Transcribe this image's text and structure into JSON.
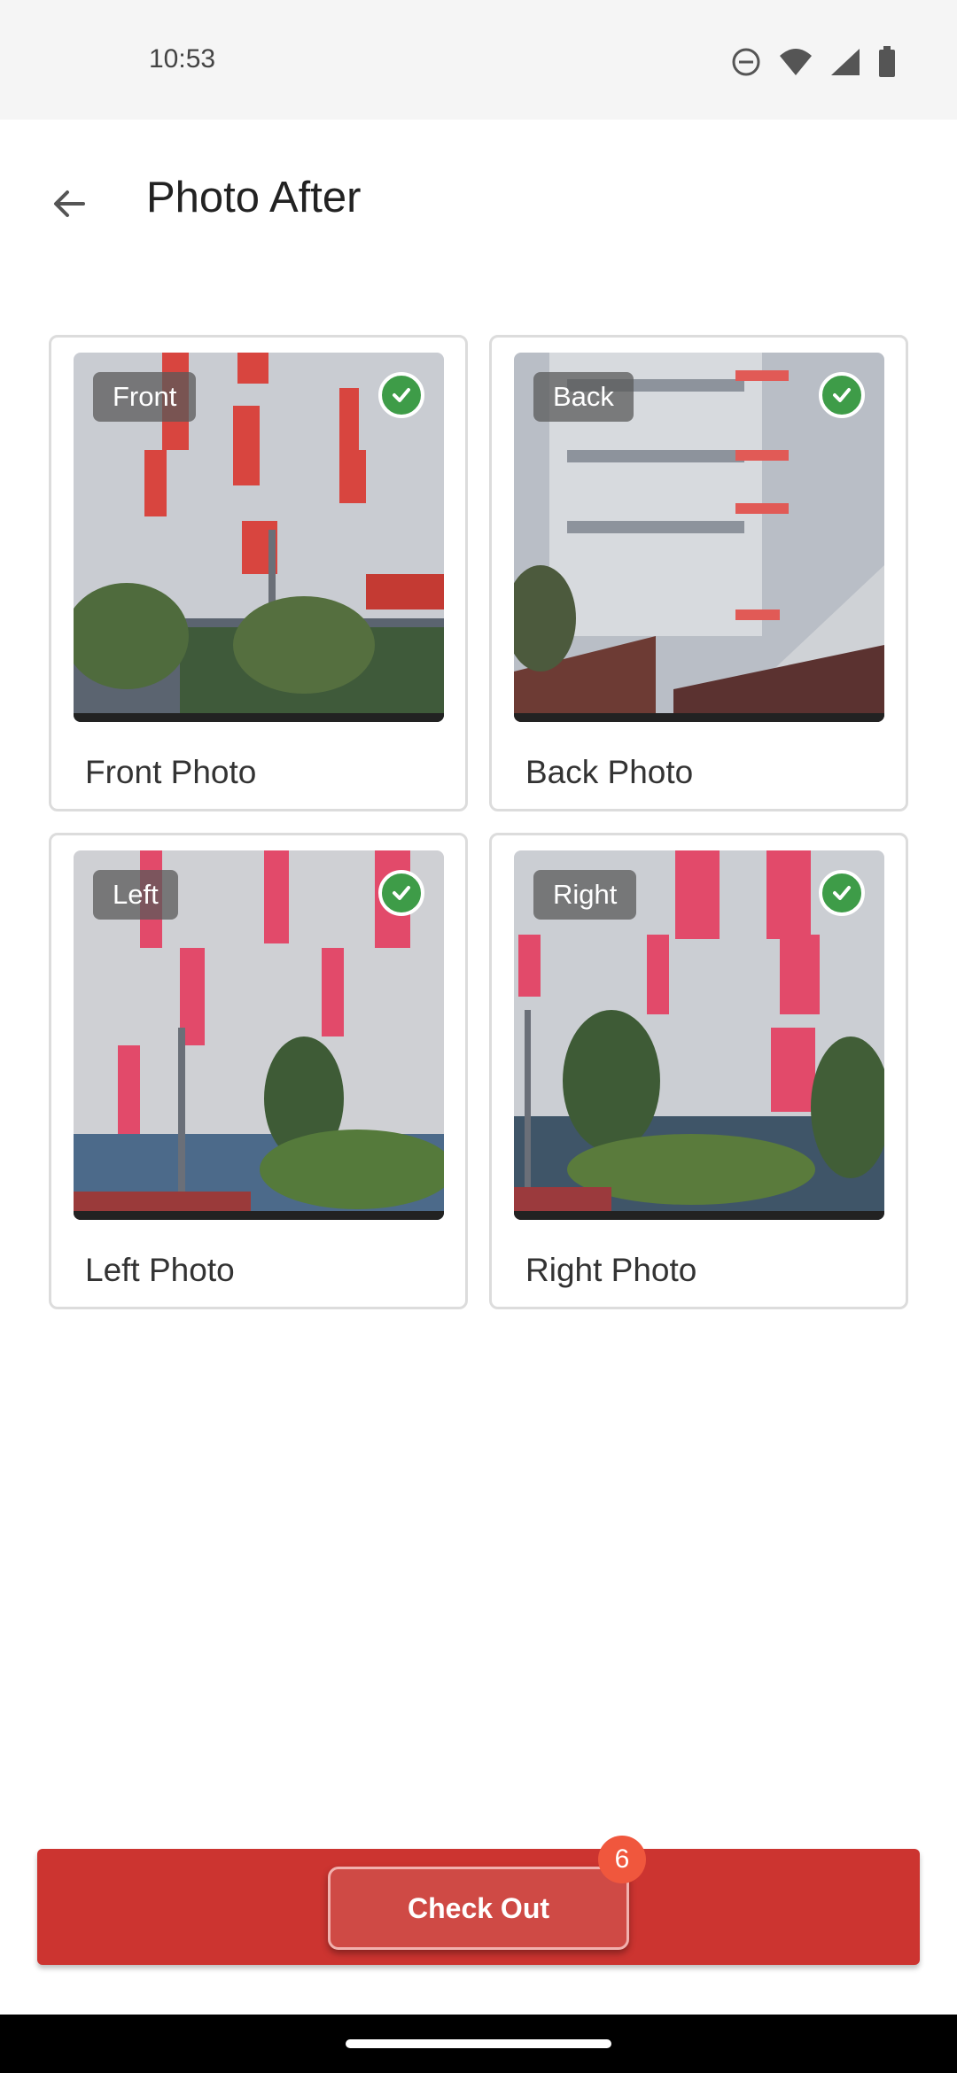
{
  "status_bar": {
    "time": "10:53",
    "icons": [
      "do-not-disturb-icon",
      "wifi-icon",
      "signal-icon",
      "battery-icon"
    ]
  },
  "header": {
    "back_icon": "arrow-left-icon",
    "title": "Photo After"
  },
  "photos": [
    {
      "tag": "Front",
      "label": "Front Photo",
      "checked": true
    },
    {
      "tag": "Back",
      "label": "Back Photo",
      "checked": true
    },
    {
      "tag": "Left",
      "label": "Left Photo",
      "checked": true
    },
    {
      "tag": "Right",
      "label": "Right Photo",
      "checked": true
    }
  ],
  "footer": {
    "checkout_label": "Check Out",
    "badge_count": "6"
  },
  "colors": {
    "primary": "#cc3430",
    "check_green": "#3e9c48",
    "badge": "#f0573d"
  }
}
